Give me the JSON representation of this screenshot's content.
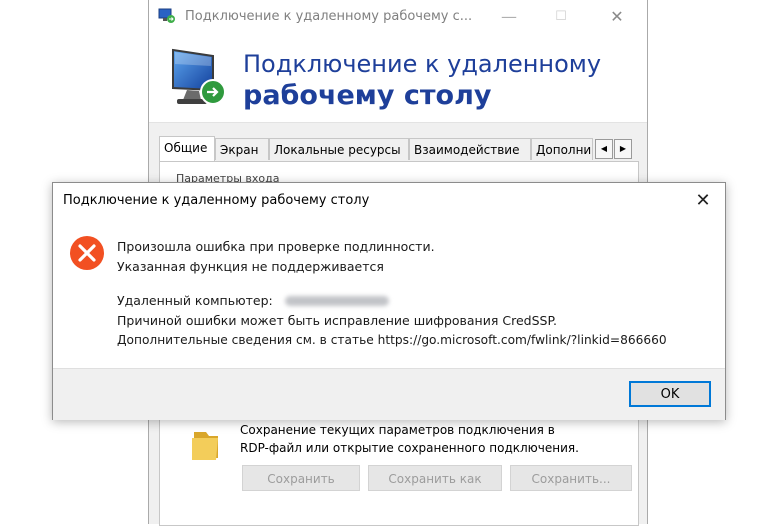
{
  "background_window": {
    "title": "Подключение к удаленному рабочему с...",
    "controls": {
      "minimize": "—",
      "maximize": "☐",
      "close": "✕"
    },
    "banner": {
      "line1": "Подключение к удаленному",
      "line2": "рабочему столу"
    },
    "tabs": [
      {
        "label": "Общие",
        "active": true
      },
      {
        "label": "Экран",
        "active": false
      },
      {
        "label": "Локальные ресурсы",
        "active": false
      },
      {
        "label": "Взаимодействие",
        "active": false
      },
      {
        "label": "Дополни",
        "active": false
      }
    ],
    "tab_scroll": {
      "left": "◀",
      "right": "▶"
    },
    "group_label": "Параметры входа",
    "save_description": {
      "line1": "Сохранение текущих параметров подключения в",
      "line2": "RDP-файл или открытие сохраненного подключения."
    },
    "buttons": {
      "save": "Сохранить",
      "save_as": "Сохранить как",
      "open": "Сохранить..."
    }
  },
  "error_dialog": {
    "title": "Подключение к удаленному рабочему столу",
    "close_glyph": "✕",
    "message_line1": "Произошла ошибка при проверке подлинности.",
    "message_line2": "Указанная функция не поддерживается",
    "remote_computer_label": "Удаленный компьютер:",
    "cause_line": "Причиной ошибки может быть исправление шифрования CredSSP.",
    "details_line": "Дополнительные сведения см. в статье https://go.microsoft.com/fwlink/?linkid=866660",
    "ok_label": "OK",
    "icon": "error-x-icon"
  },
  "colors": {
    "banner_text": "#1e3f9a",
    "error_icon": "#f25022",
    "ok_border": "#0078d7"
  }
}
